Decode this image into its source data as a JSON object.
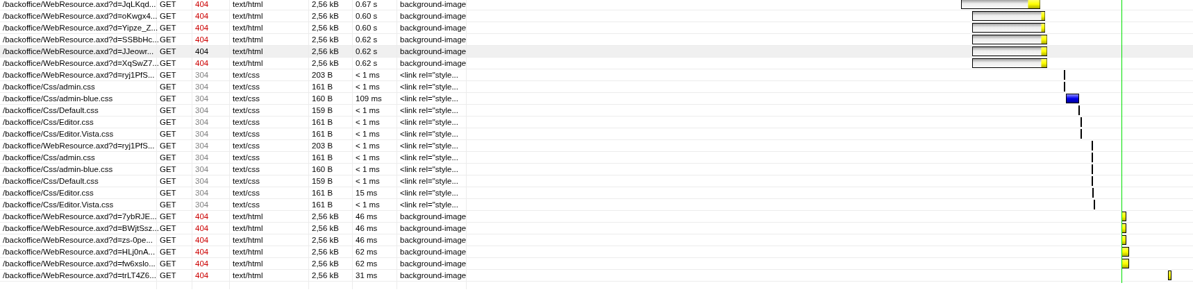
{
  "requests": [
    {
      "url": "/backoffice/WebResource.axd?d=JqLKqd...",
      "method": "GET",
      "status": "404",
      "color": "#cc0000",
      "type": "text/html",
      "size": "2,56 kB",
      "time": "0.67 s",
      "initiator": "background-image",
      "selected": false
    },
    {
      "url": "/backoffice/WebResource.axd?d=oKwgx4...",
      "method": "GET",
      "status": "404",
      "color": "#cc0000",
      "type": "text/html",
      "size": "2,56 kB",
      "time": "0.60 s",
      "initiator": "background-image",
      "selected": false
    },
    {
      "url": "/backoffice/WebResource.axd?d=Yipze_Z...",
      "method": "GET",
      "status": "404",
      "color": "#cc0000",
      "type": "text/html",
      "size": "2,56 kB",
      "time": "0.60 s",
      "initiator": "background-image",
      "selected": false
    },
    {
      "url": "/backoffice/WebResource.axd?d=SSBbHc...",
      "method": "GET",
      "status": "404",
      "color": "#cc0000",
      "type": "text/html",
      "size": "2,56 kB",
      "time": "0.62 s",
      "initiator": "background-image",
      "selected": false
    },
    {
      "url": "/backoffice/WebResource.axd?d=JJeowr...",
      "method": "GET",
      "status": "404",
      "color": "#000000",
      "type": "text/html",
      "size": "2,56 kB",
      "time": "0.62 s",
      "initiator": "background-image",
      "selected": true
    },
    {
      "url": "/backoffice/WebResource.axd?d=XqSwZ7...",
      "method": "GET",
      "status": "404",
      "color": "#cc0000",
      "type": "text/html",
      "size": "2,56 kB",
      "time": "0.62 s",
      "initiator": "background-image",
      "selected": false
    },
    {
      "url": "/backoffice/WebResource.axd?d=ryj1PfS...",
      "method": "GET",
      "status": "304",
      "color": "#808080",
      "type": "text/css",
      "size": "203 B",
      "time": "< 1 ms",
      "initiator": "<link rel=\"style...",
      "selected": false
    },
    {
      "url": "/backoffice/Css/admin.css",
      "method": "GET",
      "status": "304",
      "color": "#808080",
      "type": "text/css",
      "size": "161 B",
      "time": "< 1 ms",
      "initiator": "<link rel=\"style...",
      "selected": false
    },
    {
      "url": "/backoffice/Css/admin-blue.css",
      "method": "GET",
      "status": "304",
      "color": "#808080",
      "type": "text/css",
      "size": "160 B",
      "time": "109 ms",
      "initiator": "<link rel=\"style...",
      "selected": false
    },
    {
      "url": "/backoffice/Css/Default.css",
      "method": "GET",
      "status": "304",
      "color": "#808080",
      "type": "text/css",
      "size": "159 B",
      "time": "< 1 ms",
      "initiator": "<link rel=\"style...",
      "selected": false
    },
    {
      "url": "/backoffice/Css/Editor.css",
      "method": "GET",
      "status": "304",
      "color": "#808080",
      "type": "text/css",
      "size": "161 B",
      "time": "< 1 ms",
      "initiator": "<link rel=\"style...",
      "selected": false
    },
    {
      "url": "/backoffice/Css/Editor.Vista.css",
      "method": "GET",
      "status": "304",
      "color": "#808080",
      "type": "text/css",
      "size": "161 B",
      "time": "< 1 ms",
      "initiator": "<link rel=\"style...",
      "selected": false
    },
    {
      "url": "/backoffice/WebResource.axd?d=ryj1PfS...",
      "method": "GET",
      "status": "304",
      "color": "#808080",
      "type": "text/css",
      "size": "203 B",
      "time": "< 1 ms",
      "initiator": "<link rel=\"style...",
      "selected": false
    },
    {
      "url": "/backoffice/Css/admin.css",
      "method": "GET",
      "status": "304",
      "color": "#808080",
      "type": "text/css",
      "size": "161 B",
      "time": "< 1 ms",
      "initiator": "<link rel=\"style...",
      "selected": false
    },
    {
      "url": "/backoffice/Css/admin-blue.css",
      "method": "GET",
      "status": "304",
      "color": "#808080",
      "type": "text/css",
      "size": "160 B",
      "time": "< 1 ms",
      "initiator": "<link rel=\"style...",
      "selected": false
    },
    {
      "url": "/backoffice/Css/Default.css",
      "method": "GET",
      "status": "304",
      "color": "#808080",
      "type": "text/css",
      "size": "159 B",
      "time": "< 1 ms",
      "initiator": "<link rel=\"style...",
      "selected": false
    },
    {
      "url": "/backoffice/Css/Editor.css",
      "method": "GET",
      "status": "304",
      "color": "#808080",
      "type": "text/css",
      "size": "161 B",
      "time": "15 ms",
      "initiator": "<link rel=\"style...",
      "selected": false
    },
    {
      "url": "/backoffice/Css/Editor.Vista.css",
      "method": "GET",
      "status": "304",
      "color": "#808080",
      "type": "text/css",
      "size": "161 B",
      "time": "< 1 ms",
      "initiator": "<link rel=\"style...",
      "selected": false
    },
    {
      "url": "/backoffice/WebResource.axd?d=7ybRJE...",
      "method": "GET",
      "status": "404",
      "color": "#cc0000",
      "type": "text/html",
      "size": "2,56 kB",
      "time": "46 ms",
      "initiator": "background-image",
      "selected": false
    },
    {
      "url": "/backoffice/WebResource.axd?d=BWjtSsz...",
      "method": "GET",
      "status": "404",
      "color": "#cc0000",
      "type": "text/html",
      "size": "2,56 kB",
      "time": "46 ms",
      "initiator": "background-image",
      "selected": false
    },
    {
      "url": "/backoffice/WebResource.axd?d=zs-0pe...",
      "method": "GET",
      "status": "404",
      "color": "#cc0000",
      "type": "text/html",
      "size": "2,56 kB",
      "time": "46 ms",
      "initiator": "background-image",
      "selected": false
    },
    {
      "url": "/backoffice/WebResource.axd?d=HLj0nA...",
      "method": "GET",
      "status": "404",
      "color": "#cc0000",
      "type": "text/html",
      "size": "2,56 kB",
      "time": "62 ms",
      "initiator": "background-image",
      "selected": false
    },
    {
      "url": "/backoffice/WebResource.axd?d=fw6xslo...",
      "method": "GET",
      "status": "404",
      "color": "#cc0000",
      "type": "text/html",
      "size": "2,56 kB",
      "time": "62 ms",
      "initiator": "background-image",
      "selected": false
    },
    {
      "url": "/backoffice/WebResource.axd?d=trLT4Z6...",
      "method": "GET",
      "status": "404",
      "color": "#cc0000",
      "type": "text/html",
      "size": "2,56 kB",
      "time": "31 ms",
      "initiator": "background-image",
      "selected": false
    }
  ]
}
